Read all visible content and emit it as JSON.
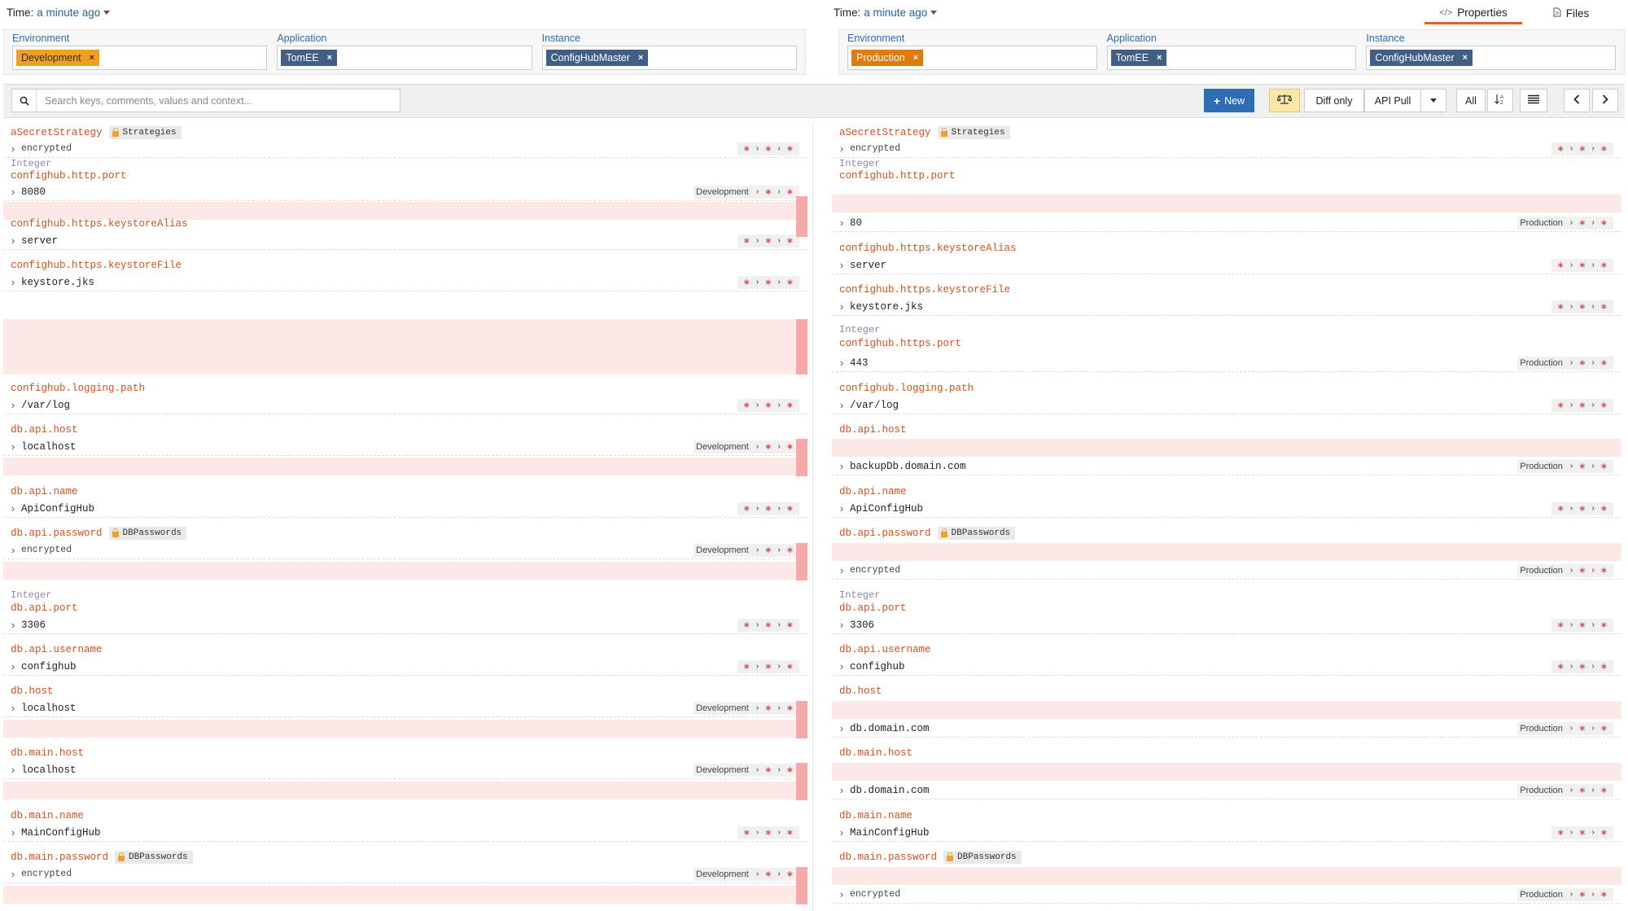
{
  "left": {
    "time_label": "Time:",
    "time_value": "a minute ago",
    "environment_label": "Environment",
    "environment_chip": "Development",
    "application_label": "Application",
    "application_chip": "TomEE",
    "instance_label": "Instance",
    "instance_chip": "ConfigHubMaster"
  },
  "right": {
    "time_label": "Time:",
    "time_value": "a minute ago",
    "environment_label": "Environment",
    "environment_chip": "Production",
    "application_label": "Application",
    "application_chip": "TomEE",
    "instance_label": "Instance",
    "instance_chip": "ConfigHubMaster"
  },
  "tabs": [
    {
      "label": "Properties",
      "icon": "code-icon",
      "active": true
    },
    {
      "label": "Files",
      "icon": "file-icon",
      "active": false
    }
  ],
  "toolbar": {
    "search_placeholder": "Search keys, comments, values and context...",
    "new_label": "New",
    "diff_only_label": "Diff only",
    "api_pull_label": "API Pull",
    "all_label": "All"
  },
  "left_props": {
    "p0": {
      "key": "aSecretStrategy",
      "tag": "Strategies",
      "value": "encrypted"
    },
    "p1": {
      "type": "Integer",
      "key": "confighub.http.port",
      "value": "8080",
      "ctx": "Development"
    },
    "p2": {
      "key": "confighub.https.keystoreAlias",
      "value": "server"
    },
    "p3": {
      "key": "confighub.https.keystoreFile",
      "value": "keystore.jks"
    },
    "p4": {
      "key": "confighub.logging.path",
      "value": "/var/log"
    },
    "p5": {
      "key": "db.api.host",
      "value": "localhost",
      "ctx": "Development"
    },
    "p6": {
      "key": "db.api.name",
      "value": "ApiConfigHub"
    },
    "p7": {
      "key": "db.api.password",
      "tag": "DBPasswords",
      "value": "encrypted",
      "ctx": "Development"
    },
    "p8": {
      "type": "Integer",
      "key": "db.api.port",
      "value": "3306"
    },
    "p9": {
      "key": "db.api.username",
      "value": "confighub"
    },
    "p10": {
      "key": "db.host",
      "value": "localhost",
      "ctx": "Development"
    },
    "p11": {
      "key": "db.main.host",
      "value": "localhost",
      "ctx": "Development"
    },
    "p12": {
      "key": "db.main.name",
      "value": "MainConfigHub"
    },
    "p13": {
      "key": "db.main.password",
      "tag": "DBPasswords",
      "value": "encrypted",
      "ctx": "Development"
    }
  },
  "right_props": {
    "p0": {
      "key": "aSecretStrategy",
      "tag": "Strategies",
      "value": "encrypted"
    },
    "p1": {
      "type": "Integer",
      "key": "confighub.http.port",
      "value": "80",
      "ctx": "Production"
    },
    "p2": {
      "key": "confighub.https.keystoreAlias",
      "value": "server"
    },
    "p3": {
      "key": "confighub.https.keystoreFile",
      "value": "keystore.jks"
    },
    "p3b": {
      "type": "Integer",
      "key": "confighub.https.port",
      "value": "443",
      "ctx": "Production"
    },
    "p4": {
      "key": "confighub.logging.path",
      "value": "/var/log"
    },
    "p5": {
      "key": "db.api.host",
      "value": "backupDb.domain.com",
      "ctx": "Production"
    },
    "p6": {
      "key": "db.api.name",
      "value": "ApiConfigHub"
    },
    "p7": {
      "key": "db.api.password",
      "tag": "DBPasswords",
      "value": "encrypted",
      "ctx": "Production"
    },
    "p8": {
      "type": "Integer",
      "key": "db.api.port",
      "value": "3306"
    },
    "p9": {
      "key": "db.api.username",
      "value": "confighub"
    },
    "p10": {
      "key": "db.host",
      "value": "db.domain.com",
      "ctx": "Production"
    },
    "p11": {
      "key": "db.main.host",
      "value": "db.domain.com",
      "ctx": "Production"
    },
    "p12": {
      "key": "db.main.name",
      "value": "MainConfigHub"
    },
    "p13": {
      "key": "db.main.password",
      "tag": "DBPasswords",
      "value": "encrypted",
      "ctx": "Production"
    }
  },
  "colors": {
    "key": "#d5501a",
    "type": "#8b84b0",
    "diff_bg": "#fde8e8",
    "diff_gutter": "#f6a9a9",
    "primary": "#2e6db4",
    "tab_accent": "#e0622a"
  }
}
